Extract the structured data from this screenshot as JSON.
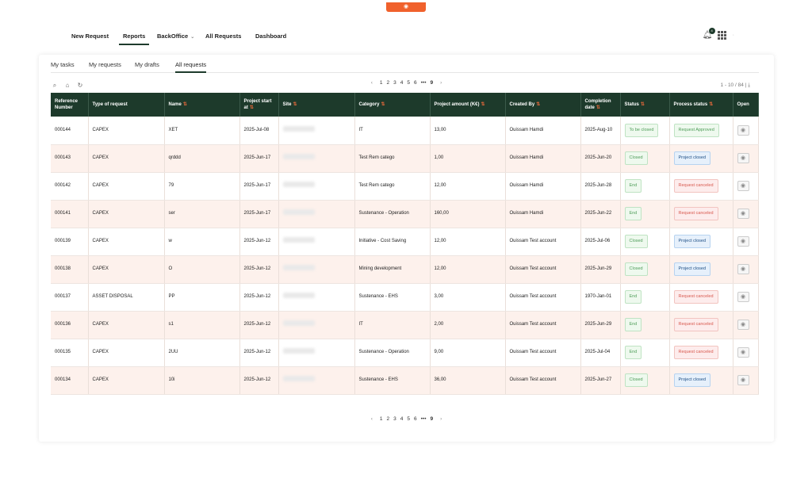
{
  "nav": {
    "items": [
      "New Request",
      "Reports",
      "BackOffice",
      "All Requests",
      "Dashboard"
    ],
    "notification_count": "4"
  },
  "subtabs": [
    "My tasks",
    "My requests",
    "My drafts",
    "All requests"
  ],
  "pagination": {
    "pages": [
      "1",
      "2",
      "3",
      "4",
      "5",
      "6",
      "•••",
      "9"
    ],
    "count_label": "1 - 10 / 84 |"
  },
  "table": {
    "columns": [
      "Reference Number",
      "Type of request",
      "Name",
      "Project start at",
      "Site",
      "Category",
      "Project amount (K€)",
      "Created By",
      "Completion date",
      "Status",
      "Process status",
      "Open"
    ],
    "rows": [
      {
        "ref": "000144",
        "type": "CAPEX",
        "name": "XET",
        "start": "2025-Jul-08",
        "category": "IT",
        "amount": "13,00",
        "created_by": "Ouissam Hamdi",
        "completion": "2025-Aug-10",
        "status": "To be closed",
        "process": "Request Approved"
      },
      {
        "ref": "000143",
        "type": "CAPEX",
        "name": "qrddd",
        "start": "2025-Jun-17",
        "category": "Test Rem catego",
        "amount": "1,00",
        "created_by": "Ouissam Hamdi",
        "completion": "2025-Jun-20",
        "status": "Closed",
        "process": "Project closed"
      },
      {
        "ref": "000142",
        "type": "CAPEX",
        "name": "79",
        "start": "2025-Jun-17",
        "category": "Test Rem catego",
        "amount": "12,00",
        "created_by": "Ouissam Hamdi",
        "completion": "2025-Jun-28",
        "status": "End",
        "process": "Request canceled"
      },
      {
        "ref": "000141",
        "type": "CAPEX",
        "name": "ser",
        "start": "2025-Jun-17",
        "category": "Sustenance - Operation",
        "amount": "160,00",
        "created_by": "Ouissam Hamdi",
        "completion": "2025-Jun-22",
        "status": "End",
        "process": "Request canceled"
      },
      {
        "ref": "000139",
        "type": "CAPEX",
        "name": "w",
        "start": "2025-Jun-12",
        "category": "Initiative - Cost Saving",
        "amount": "12,00",
        "created_by": "Ouissam Test account",
        "completion": "2025-Jul-06",
        "status": "Closed",
        "process": "Project closed"
      },
      {
        "ref": "000138",
        "type": "CAPEX",
        "name": "O",
        "start": "2025-Jun-12",
        "category": "Mining development",
        "amount": "12,00",
        "created_by": "Ouissam Test account",
        "completion": "2025-Jun-29",
        "status": "Closed",
        "process": "Project closed"
      },
      {
        "ref": "000137",
        "type": "ASSET DISPOSAL",
        "name": "PP",
        "start": "2025-Jun-12",
        "category": "Sustenance - EHS",
        "amount": "3,00",
        "created_by": "Ouissam Test account",
        "completion": "1970-Jan-01",
        "status": "End",
        "process": "Request canceled"
      },
      {
        "ref": "000136",
        "type": "CAPEX",
        "name": "s1",
        "start": "2025-Jun-12",
        "category": "IT",
        "amount": "2,00",
        "created_by": "Ouissam Test account",
        "completion": "2025-Jun-29",
        "status": "End",
        "process": "Request canceled"
      },
      {
        "ref": "000135",
        "type": "CAPEX",
        "name": "2UU",
        "start": "2025-Jun-12",
        "category": "Sustenance - Operation",
        "amount": "9,00",
        "created_by": "Ouissam Test account",
        "completion": "2025-Jul-04",
        "status": "End",
        "process": "Request canceled"
      },
      {
        "ref": "000134",
        "type": "CAPEX",
        "name": "10i",
        "start": "2025-Jun-12",
        "category": "Sustenance - EHS",
        "amount": "36,00",
        "created_by": "Ouissam Test account",
        "completion": "2025-Jun-27",
        "status": "Closed",
        "process": "Project closed"
      }
    ]
  },
  "colors": {
    "header_bg": "#1d3a2b",
    "accent_orange": "#f0612c",
    "row_alt_bg": "#fdf1ec"
  }
}
